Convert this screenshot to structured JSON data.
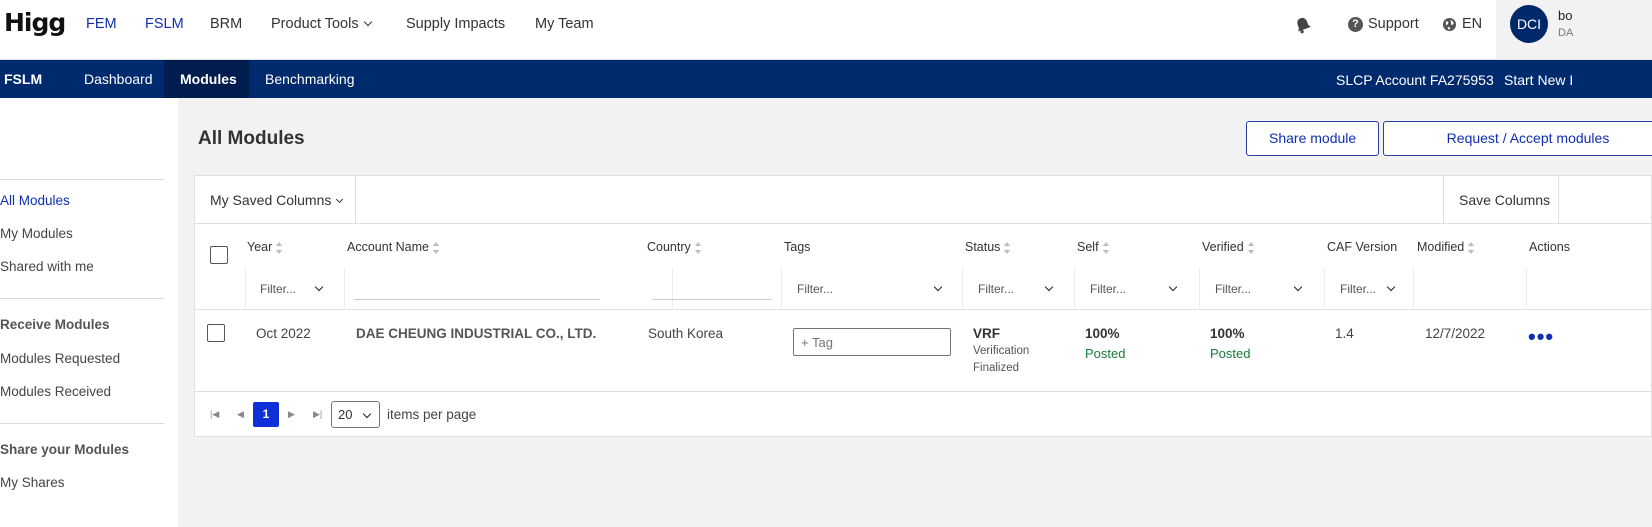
{
  "header": {
    "logo": "Higg",
    "nav": [
      "FEM",
      "FSLM",
      "BRM",
      "Product Tools",
      "Supply Impacts",
      "My Team"
    ],
    "support": "Support",
    "language": "EN",
    "avatar_initials": "DCI",
    "user_name": "bo",
    "user_org": "DA"
  },
  "subnav": {
    "brand": "FSLM",
    "tabs": [
      "Dashboard",
      "Modules",
      "Benchmarking"
    ],
    "account": "SLCP Account FA275953",
    "start_new": "Start New I"
  },
  "sidebar": {
    "items": [
      "All Modules",
      "My Modules",
      "Shared with me"
    ],
    "receive_heading": "Receive Modules",
    "receive_items": [
      "Modules Requested",
      "Modules Received"
    ],
    "share_heading": "Share your Modules",
    "share_items": [
      "My Shares"
    ]
  },
  "main": {
    "title": "All Modules",
    "share_button": "Share module",
    "request_button": "Request / Accept modules",
    "saved_columns": "My Saved Columns",
    "save_columns": "Save Columns",
    "columns": [
      "Year",
      "Account Name",
      "Country",
      "Tags",
      "Status",
      "Self",
      "Verified",
      "CAF Version",
      "Modified",
      "Actions"
    ],
    "filter_placeholder": "Filter...",
    "rows": [
      {
        "year": "Oct 2022",
        "account": "DAE CHEUNG INDUSTRIAL CO., LTD.",
        "country": "South Korea",
        "tag_placeholder": "+ Tag",
        "status": "VRF",
        "status_line1": "Verification",
        "status_line2": "Finalized",
        "self_pct": "100%",
        "self_state": "Posted",
        "verified_pct": "100%",
        "verified_state": "Posted",
        "caf": "1.4",
        "modified": "12/7/2022",
        "actions": "•••"
      }
    ],
    "pager": {
      "current_page": "1",
      "per_page": "20",
      "per_page_label": "items per page"
    }
  },
  "colors": {
    "navy": "#002a6e",
    "link_blue": "#0f2fb0",
    "posted_green": "#1a7a3a"
  }
}
